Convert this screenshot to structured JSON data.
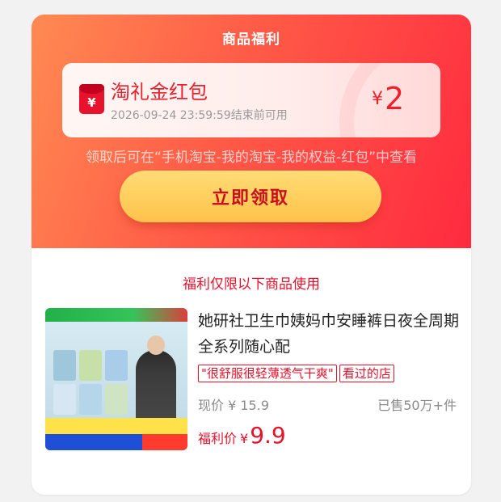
{
  "header": {
    "title": "商品福利"
  },
  "coupon": {
    "icon": "red-packet-icon",
    "icon_symbol": "¥",
    "name": "淘礼金红包",
    "valid_until": "2026-09-24 23:59:59结束前可用",
    "currency": "¥",
    "amount": "2"
  },
  "hint": "领取后可在“手机淘宝-我的淘宝-我的权益-红包”中查看",
  "claim_button": {
    "label": "立即领取"
  },
  "restriction": "福利仅限以下商品使用",
  "product": {
    "image": "product-thumbnail",
    "title": "她研社卫生巾姨妈巾安睡裤日夜全周期全系列随心配",
    "tags": [
      "\"很舒服很轻薄透气干爽\"",
      "看过的店"
    ],
    "current_price_label": "现价",
    "current_price": "¥ 15.9",
    "sold": "已售50万+件",
    "benefit_label": "福利价",
    "benefit_currency": "¥",
    "benefit_price": "9.9"
  },
  "colors": {
    "header_gradient_start": "#ff8a52",
    "header_gradient_end": "#ff2a3f",
    "accent_red": "#e8112a",
    "button_yellow": "#ffc24a"
  }
}
